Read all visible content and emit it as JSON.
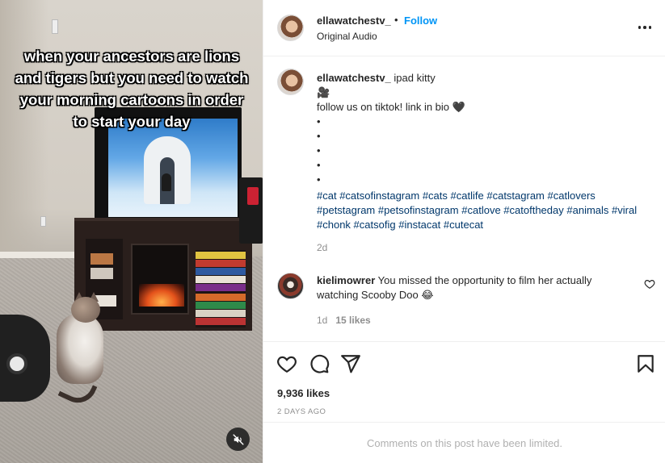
{
  "media": {
    "overlay_text": "when your ancestors are lions and tigers but you need to watch your morning cartoons in order to start your day",
    "mute_icon": "speaker-muted-icon"
  },
  "header": {
    "username": "ellawatchestv_",
    "separator": "•",
    "follow_label": "Follow",
    "audio_label": "Original Audio",
    "more_icon": "more-options-icon"
  },
  "caption": {
    "username": "ellawatchestv_",
    "title": "ipad kitty",
    "camera_emoji": "🎥",
    "line2": "follow us on tiktok! link in bio 🖤",
    "dots": [
      "•",
      "•",
      "•",
      "•",
      "•"
    ],
    "hashtags": [
      "#cat",
      "#catsofinstagram",
      "#cats",
      "#catlife",
      "#catstagram",
      "#catlovers",
      "#petstagram",
      "#petsofinstagram",
      "#catlove",
      "#catoftheday",
      "#animals",
      "#viral",
      "#chonk",
      "#catsofig",
      "#instacat",
      "#cutecat"
    ],
    "time": "2d"
  },
  "comment": {
    "username": "kielimowrer",
    "text": "You missed the opportunity to film her actually watching Scooby Doo 😂",
    "time": "1d",
    "likes": "15 likes"
  },
  "actions": {
    "likes_count": "9,936 likes",
    "posted_ago": "2 DAYS AGO"
  },
  "footer": {
    "limited_text": "Comments on this post have been limited."
  }
}
